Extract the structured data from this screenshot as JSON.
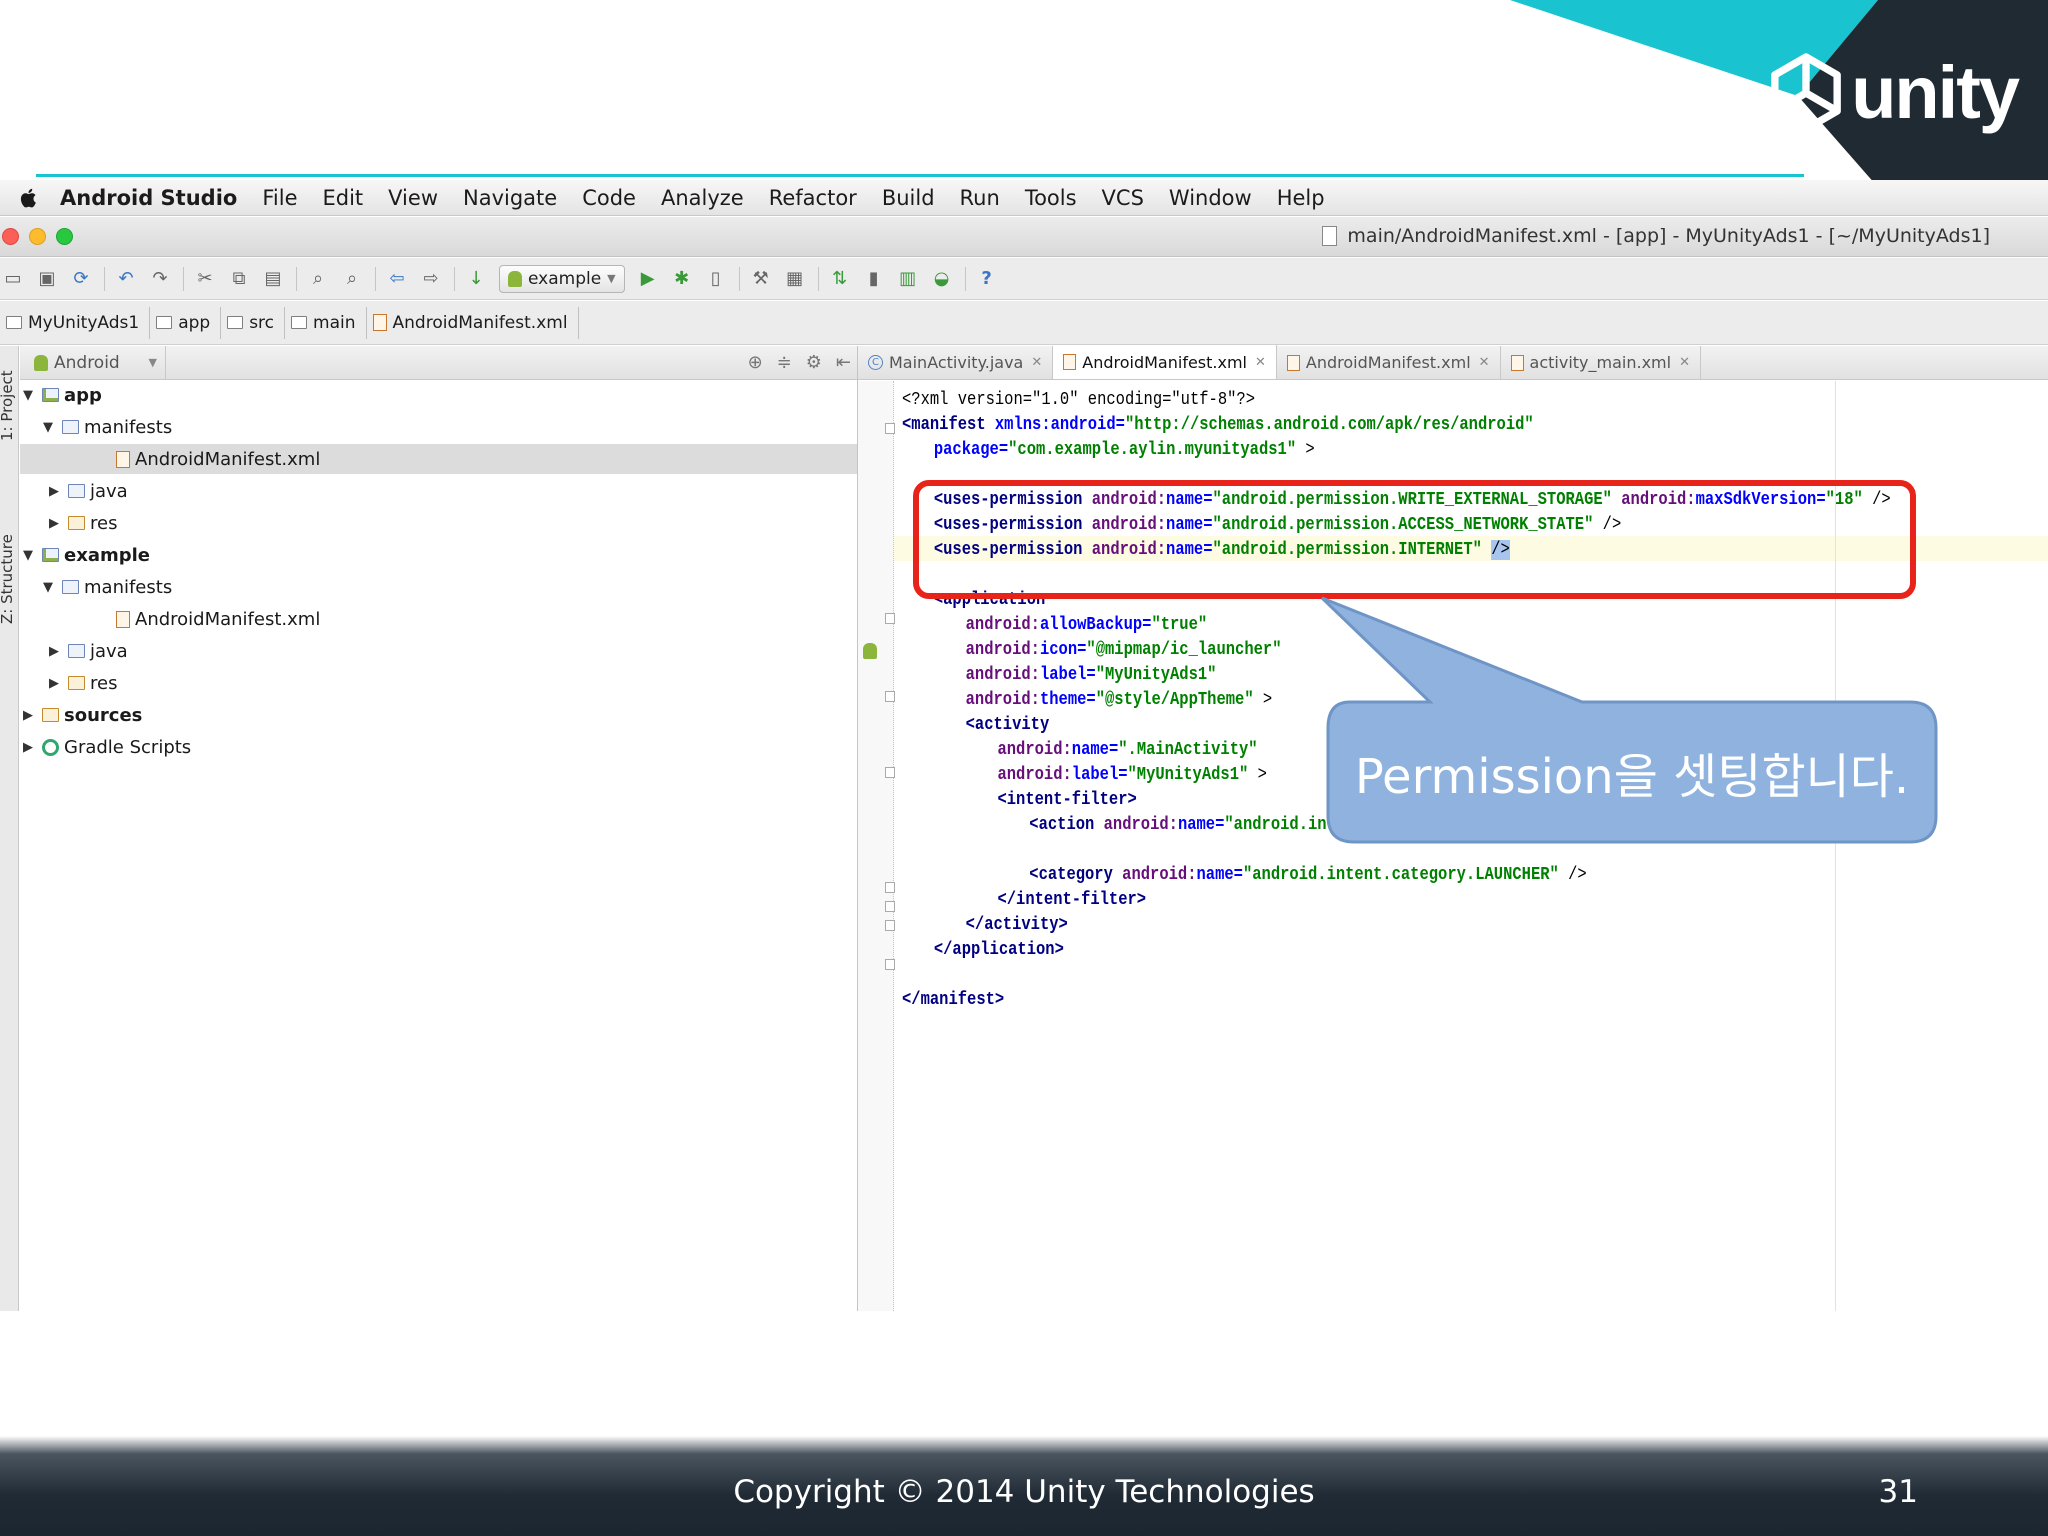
{
  "slide": {
    "brand": "unity",
    "copyright": "Copyright © 2014 Unity Technologies",
    "page_number": "31",
    "callout_text": "Permission을 셋팅합니다.",
    "colors": {
      "accent_cyan": "#19c3cf",
      "dark": "#1f2a33",
      "callout_fill": "#8fb3de",
      "highlight_red": "#e8241a"
    }
  },
  "menubar": {
    "app_name": "Android Studio",
    "items": [
      "File",
      "Edit",
      "View",
      "Navigate",
      "Code",
      "Analyze",
      "Refactor",
      "Build",
      "Run",
      "Tools",
      "VCS",
      "Window",
      "Help"
    ]
  },
  "window": {
    "title": "main/AndroidManifest.xml - [app] - MyUnityAds1 - [~/MyUnityAds1]"
  },
  "toolbar": {
    "run_config": "example",
    "icons": [
      "open-icon",
      "save-icon",
      "sync-icon",
      "undo-icon",
      "redo-icon",
      "cut-icon",
      "copy-icon",
      "paste-icon",
      "find-icon",
      "replace-icon",
      "back-icon",
      "forward-icon",
      "make-icon",
      "run-icon",
      "debug-icon",
      "attach-icon",
      "project-structure-icon",
      "sdk-manager-icon",
      "gradle-sync-icon",
      "avd-manager-icon",
      "device-monitor-icon",
      "android-icon",
      "help-icon"
    ]
  },
  "breadcrumb": [
    "MyUnityAds1",
    "app",
    "src",
    "main",
    "AndroidManifest.xml"
  ],
  "sidebar_tools": [
    "1: Project",
    "Z: Structure"
  ],
  "project": {
    "view_mode": "Android",
    "tree": [
      {
        "label": "app",
        "bold": true
      },
      {
        "label": "manifests"
      },
      {
        "label": "AndroidManifest.xml"
      },
      {
        "label": "java"
      },
      {
        "label": "res"
      },
      {
        "label": "example",
        "bold": true
      },
      {
        "label": "manifests"
      },
      {
        "label": "AndroidManifest.xml"
      },
      {
        "label": "java"
      },
      {
        "label": "res"
      },
      {
        "label": "sources",
        "bold": true
      },
      {
        "label": "Gradle Scripts"
      }
    ]
  },
  "editor": {
    "tabs": [
      "MainActivity.java",
      "AndroidManifest.xml",
      "AndroidManifest.xml",
      "activity_main.xml"
    ],
    "active_tab": "AndroidManifest.xml",
    "code": {
      "l1": "<?xml version=\"1.0\" encoding=\"utf-8\"?>",
      "l2_tag": "<manifest",
      "l2_attr": " xmlns:android=",
      "l2_val": "\"http://schemas.android.com/apk/res/android\"",
      "l3_attr": "package=",
      "l3_val": "\"com.example.aylin.myunityads1\"",
      "l3_end": " >",
      "perm_tag": "<uses-permission",
      "perm_ns": " android:",
      "perm_attr": "name=",
      "p1_val": "\"android.permission.WRITE_EXTERNAL_STORAGE\"",
      "p1_ns2": " android:",
      "p1_attr2": "maxSdkVersion=",
      "p1_val2": "\"18\"",
      "close": " />",
      "p2_val": "\"android.permission.ACCESS_NETWORK_STATE\"",
      "p3_val": "\"android.permission.INTERNET\"",
      "p3_end": "/>",
      "app_tag": "<application",
      "ns": "android:",
      "allowBackup": "allowBackup=",
      "allowBackup_val": "\"true\"",
      "icon": "icon=",
      "icon_val": "\"@mipmap/ic_launcher\"",
      "label": "label=",
      "label_val": "\"MyUnityAds1\"",
      "theme": "theme=",
      "theme_val": "\"@style/AppTheme\"",
      "gt": " >",
      "activity_tag": "<activity",
      "name": "name=",
      "act_name_val": "\".MainActivity\"",
      "intent_tag": "<intent-filter>",
      "action_tag": "<action",
      "action_val": "\"android.intent.action.MAIN\"",
      "category_tag": "<category",
      "category_val": "\"android.intent.category.LAUNCHER\"",
      "intent_close": "</intent-filter>",
      "activity_close": "</activity>",
      "app_close": "</application>",
      "manifest_close": "</manifest>"
    }
  }
}
